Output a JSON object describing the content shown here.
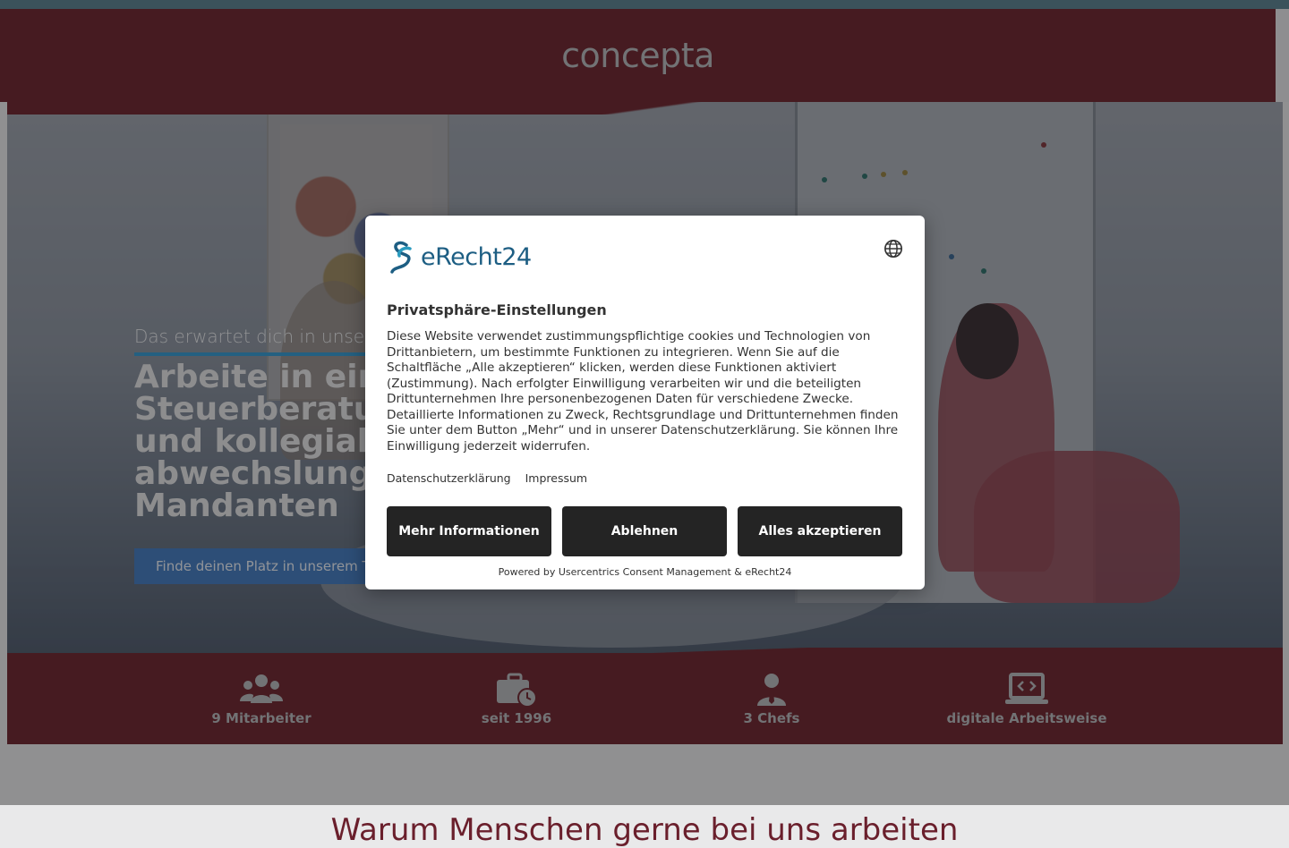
{
  "header": {
    "logo_text": "concepta"
  },
  "hero": {
    "subtitle": "Das erwartet dich in unserem Team",
    "title": "Arbeite in einer modernen Steuerberatungskanzlei mit einem jungen und kollegialen Team und abwechslungsreichen Aufgaben für unsere Mandanten",
    "cta_label": "Finde deinen Platz in unserem Team"
  },
  "stats": [
    {
      "icon": "users-icon",
      "label": "9 Mitarbeiter"
    },
    {
      "icon": "briefcase-clock-icon",
      "label": "seit 1996"
    },
    {
      "icon": "user-tie-icon",
      "label": "3 Chefs"
    },
    {
      "icon": "laptop-code-icon",
      "label": "digitale Arbeitsweise"
    }
  ],
  "section": {
    "title": "Warum Menschen gerne bei uns arbeiten"
  },
  "consent": {
    "brand_text": "eRecht24",
    "title": "Privatsphäre-Einstellungen",
    "description": "Diese Website verwendet zustimmungspflichtige cookies und Technologien von Drittanbietern, um bestimmte Funktionen zu integrieren. Wenn Sie auf die Schaltfläche „Alle akzeptieren“ klicken, werden diese Funktionen aktiviert (Zustimmung). Nach erfolgter Einwilligung verarbeiten wir und die beteiligten Drittunternehmen Ihre personenbezogenen Daten für verschiedene Zwecke. Detaillierte Informationen zu Zweck, Rechtsgrundlage und Drittunternehmen finden Sie unter dem Button „Mehr“ und in unserer Datenschutzerklärung. Sie können Ihre Einwilligung jederzeit widerrufen.",
    "links": {
      "privacy": "Datenschutzerklärung",
      "imprint": "Impressum"
    },
    "buttons": {
      "more": "Mehr Informationen",
      "deny": "Ablehnen",
      "accept": "Alles akzeptieren"
    },
    "powered_by": "Powered by Usercentrics Consent Management & eRecht24"
  },
  "colors": {
    "brand_maroon": "#722c36",
    "accent_blue": "#3b9bd0",
    "button_dark": "#242424",
    "erecht_blue": "#1d5e83"
  }
}
